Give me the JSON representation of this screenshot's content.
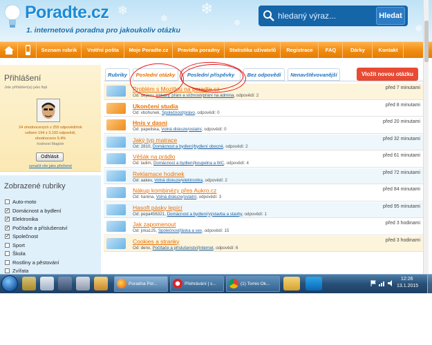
{
  "header": {
    "logo": "Poradte.cz",
    "tagline": "1. internetová poradna pro jakoukoliv otázku",
    "search_placeholder": "hledaný výraz...",
    "search_button": "Hledat"
  },
  "nav": {
    "items": [
      "Seznam rubrik",
      "Vnitřní pošta",
      "Moje Poradte.cz",
      "Pravidla poradny",
      "Statistika uživatelů",
      "Registrace",
      "FAQ",
      "Dárky",
      "Kontakt"
    ]
  },
  "login": {
    "title": "Přihlášení",
    "subtitle": "Jste přihlášen(a) jako ltqk",
    "stats": [
      "24 ohodnocených z 255 odpovědí/rok",
      "celkem 194 z 3.193 odpovědí,",
      "ohodnoceno 9,4%",
      "hodnost Magistr"
    ],
    "logout_button": "Odhlásit",
    "reset_link": "označit vše jako přečtené"
  },
  "topics": {
    "title": "Zobrazené rubriky",
    "items": [
      {
        "label": "Auto-moto",
        "checked": false,
        "mark": ""
      },
      {
        "label": "Domácnost a bydlení",
        "checked": true,
        "mark": "✓"
      },
      {
        "label": "Elektronika",
        "checked": true,
        "mark": "✓"
      },
      {
        "label": "Počítače a příslušenství",
        "checked": true,
        "mark": "✓"
      },
      {
        "label": "Společnost",
        "checked": true,
        "mark": "✓"
      },
      {
        "label": "Sport",
        "checked": false,
        "mark": ""
      },
      {
        "label": "Škola",
        "checked": false,
        "mark": ""
      },
      {
        "label": "Rostliny a pěstování",
        "checked": false,
        "mark": ""
      },
      {
        "label": "Zvířata",
        "checked": false,
        "mark": ""
      }
    ]
  },
  "tabs": {
    "items": [
      "Rubriky",
      "Poslední otázky",
      "Poslední příspěvky",
      "Bez odpovědí",
      "Nenavštěvovanější"
    ],
    "active_index": 1,
    "new_question_button": "Vložit novou otázku"
  },
  "questions": [
    {
      "title": "Problém s Mozillou na poradte.cz",
      "meta_prefix": "Od: dejavu,",
      "cat1": "Vzkazy, přání a stížnosti",
      "cat2": "přání na admina",
      "meta_suffix": ", odpovědí: 2",
      "time": "před 7 minutami",
      "style": "hi",
      "icon": "blue",
      "bold": false
    },
    {
      "title": "Ukončení studia",
      "meta_prefix": "Od: vbohunek,",
      "cat1": "Společnost",
      "cat2": "právo",
      "meta_suffix": ", odpovědí: 0",
      "time": "před 8 minutami",
      "style": "odd",
      "icon": "orange",
      "bold": true
    },
    {
      "title": "Hnis v dasni",
      "meta_prefix": "Od: papeliska,",
      "cat1": "Volná diskuze",
      "cat2": "ostatní",
      "meta_suffix": ", odpovědí: 0",
      "time": "před 20 minutami",
      "style": "odd",
      "icon": "orange",
      "bold": true
    },
    {
      "title": "Jaký typ matrace",
      "meta_prefix": "Od: 2810,",
      "cat1": "Domácnost a bydlení",
      "cat2": "bydlení obecně",
      "meta_suffix": ", odpovědí: 2",
      "time": "před 32 minutami",
      "style": "even",
      "icon": "blue",
      "bold": false
    },
    {
      "title": "Věšák na prádlo",
      "meta_prefix": "Od: ladim,",
      "cat1": "Domácnost a bydlení",
      "cat2": "koupelna a WC",
      "meta_suffix": ", odpovědí: 4",
      "time": "před 61 minutami",
      "style": "odd",
      "icon": "blue",
      "bold": false
    },
    {
      "title": "Reklamace hodinek",
      "meta_prefix": "Od: aakev,",
      "cat1": "Volná diskuze",
      "cat2": "elektronika",
      "meta_suffix": ", odpovědí: 2",
      "time": "před 72 minutami",
      "style": "even",
      "icon": "blue",
      "bold": false
    },
    {
      "title": "Nákup kombinézy přes Aukro.cz",
      "meta_prefix": "Od: hanina,",
      "cat1": "Volná diskuze",
      "cat2": "ostatní",
      "meta_suffix": ", odpovědí: 3",
      "time": "před 84 minutami",
      "style": "odd",
      "icon": "blue",
      "bold": false
    },
    {
      "title": "Hasoft pásky lepící",
      "meta_prefix": "Od: pepa456321,",
      "cat1": "Domácnost a bydlení",
      "cat2": "výstavba a stavby",
      "meta_suffix": ", odpovědí: 1",
      "time": "před 95 minutami",
      "style": "even",
      "icon": "blue",
      "bold": false
    },
    {
      "title": "Jak zapomenout",
      "meta_prefix": "Od: jirka125,",
      "cat1": "Společnost",
      "cat2": "láska a sex",
      "meta_suffix": ", odpovědí: 15",
      "time": "před 3 hodinami",
      "style": "odd",
      "icon": "blue",
      "bold": false
    },
    {
      "title": "Cookies a stranky",
      "meta_prefix": "Od: denx,",
      "cat1": "Počítače a příslušenství",
      "cat2": "internet",
      "meta_suffix": ", odpovědí: 6",
      "time": "před 3 hodinami",
      "style": "hi",
      "icon": "blue",
      "bold": false
    }
  ],
  "taskbar": {
    "tasks": [
      "Poradna Por...",
      "Přehrávání | s...",
      "(1) Tomio Ok..."
    ],
    "time": "12:26",
    "date": "13.1.2015"
  }
}
